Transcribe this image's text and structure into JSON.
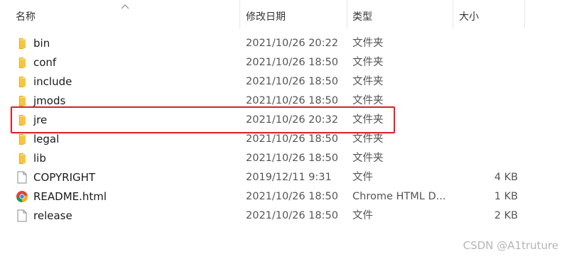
{
  "columns": {
    "name": "名称",
    "modified": "修改日期",
    "type": "类型",
    "size": "大小"
  },
  "files": [
    {
      "name": "bin",
      "date": "2021/10/26 20:22",
      "type": "文件夹",
      "size": "",
      "icon": "folder-icon"
    },
    {
      "name": "conf",
      "date": "2021/10/26 18:50",
      "type": "文件夹",
      "size": "",
      "icon": "folder-icon"
    },
    {
      "name": "include",
      "date": "2021/10/26 18:50",
      "type": "文件夹",
      "size": "",
      "icon": "folder-icon"
    },
    {
      "name": "jmods",
      "date": "2021/10/26 18:50",
      "type": "文件夹",
      "size": "",
      "icon": "folder-icon"
    },
    {
      "name": "jre",
      "date": "2021/10/26 20:32",
      "type": "文件夹",
      "size": "",
      "icon": "folder-icon"
    },
    {
      "name": "legal",
      "date": "2021/10/26 18:50",
      "type": "文件夹",
      "size": "",
      "icon": "folder-icon"
    },
    {
      "name": "lib",
      "date": "2021/10/26 18:50",
      "type": "文件夹",
      "size": "",
      "icon": "folder-icon"
    },
    {
      "name": "COPYRIGHT",
      "date": "2019/12/11 9:31",
      "type": "文件",
      "size": "4 KB",
      "icon": "file-icon"
    },
    {
      "name": "README.html",
      "date": "2021/10/26 18:50",
      "type": "Chrome HTML D...",
      "size": "1 KB",
      "icon": "chrome-icon"
    },
    {
      "name": "release",
      "date": "2021/10/26 18:50",
      "type": "文件",
      "size": "2 KB",
      "icon": "file-icon"
    }
  ],
  "highlighted_row": "jre",
  "colors": {
    "highlight": "#d9272b",
    "folder": "#f8c542"
  },
  "watermark": "CSDN @A1truture"
}
